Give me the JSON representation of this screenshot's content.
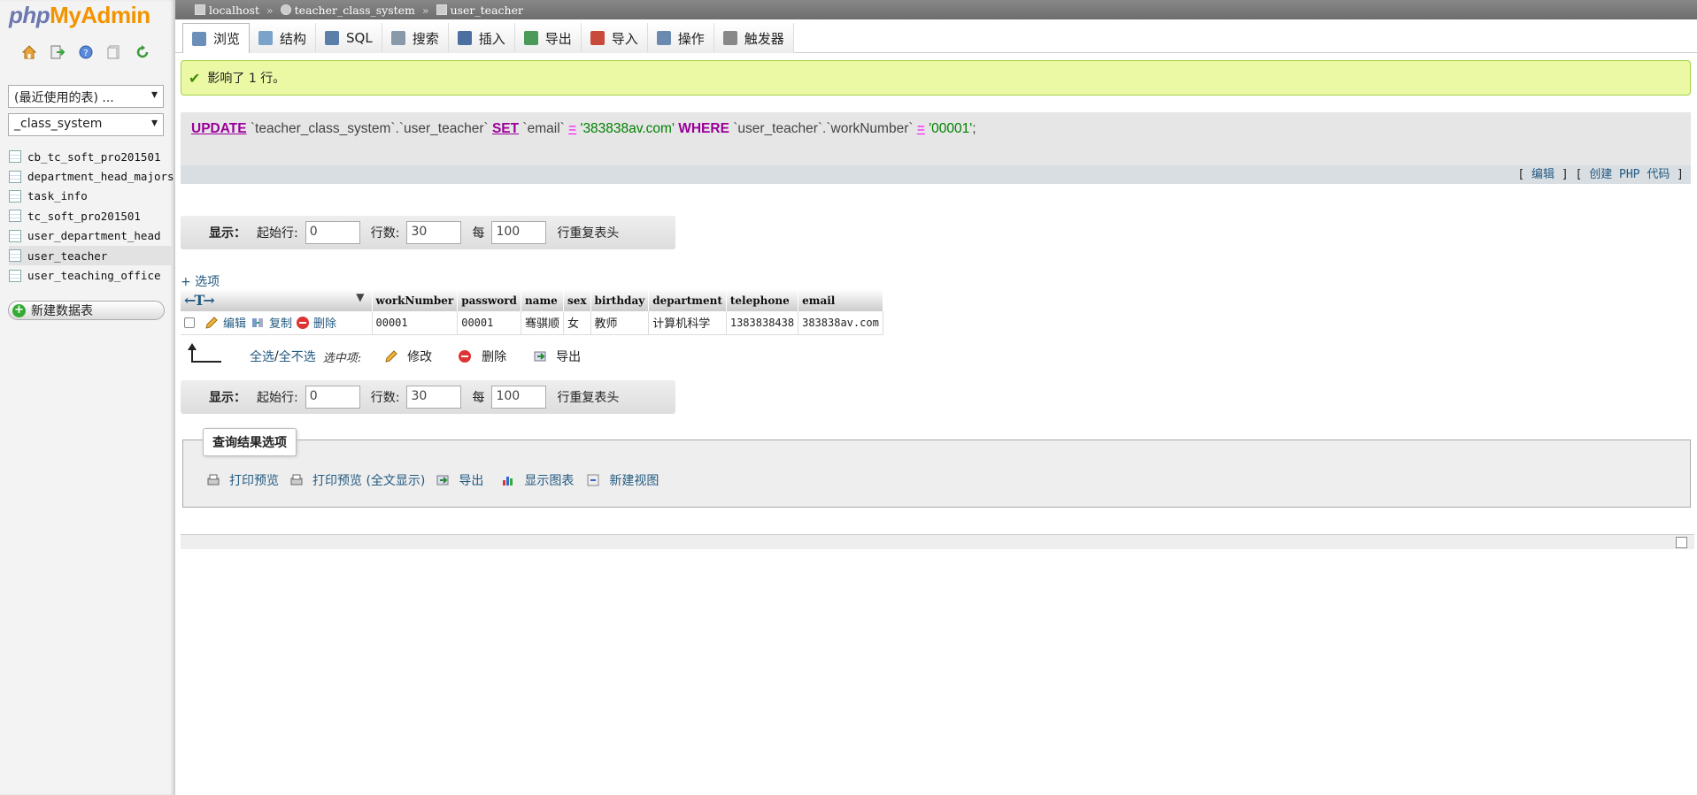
{
  "logo": {
    "php": "php",
    "my": "My",
    "admin": "Admin"
  },
  "sidebar": {
    "recent_select": "(最近使用的表) ...",
    "db_select": "_class_system",
    "tables": [
      "cb_tc_soft_pro201501",
      "department_head_majors",
      "task_info",
      "tc_soft_pro201501",
      "user_department_head",
      "user_teacher",
      "user_teaching_office"
    ],
    "active_table": "user_teacher",
    "new_table": "新建数据表"
  },
  "breadcrumb": {
    "server": "localhost",
    "database": "teacher_class_system",
    "table": "user_teacher"
  },
  "tabs": [
    {
      "label": "浏览",
      "icon": "browse-icon",
      "color": "#6b8fb8"
    },
    {
      "label": "结构",
      "icon": "structure-icon",
      "color": "#7aa3c9"
    },
    {
      "label": "SQL",
      "icon": "sql-icon",
      "color": "#5a7fa8"
    },
    {
      "label": "搜索",
      "icon": "search-icon",
      "color": "#8899aa"
    },
    {
      "label": "插入",
      "icon": "insert-icon",
      "color": "#4a6fa0"
    },
    {
      "label": "导出",
      "icon": "export-icon",
      "color": "#4a9a5a"
    },
    {
      "label": "导入",
      "icon": "import-icon",
      "color": "#c84a3a"
    },
    {
      "label": "操作",
      "icon": "wrench-icon",
      "color": "#6a8ab0"
    },
    {
      "label": "触发器",
      "icon": "trigger-icon",
      "color": "#888888"
    }
  ],
  "success_message": "影响了 1 行。",
  "sql": {
    "update": "UPDATE",
    "table_ref": " `teacher_class_system`.`user_teacher` ",
    "set": "SET",
    "col": " `email` ",
    "eq": "=",
    "val": " '383838av.com' ",
    "where": "WHERE",
    "col2": " `user_teacher`.`workNumber` ",
    "eq2": "=",
    "val2": " '00001'",
    "end": ";"
  },
  "sql_links": {
    "open": "[ ",
    "edit": "编辑",
    "mid": " ] [ ",
    "create_php": "创建 PHP 代码",
    "close": " ]"
  },
  "nav": {
    "show": "显示：",
    "start_label": "起始行:",
    "start_value": "0",
    "rows_label": "行数:",
    "rows_value": "30",
    "per_label": "每",
    "per_value": "100",
    "repeat_label": "行重复表头"
  },
  "options_link": "+ 选项",
  "columns": [
    "workNumber",
    "password",
    "name",
    "sex",
    "birthday",
    "department",
    "telephone",
    "email"
  ],
  "row": {
    "edit": "编辑",
    "copy": "复制",
    "delete": "删除",
    "values": [
      "00001",
      "00001",
      "骞骐顺",
      "女",
      "教师",
      "计算机科学",
      "1383838438",
      "383838av.com"
    ]
  },
  "bulk": {
    "check_all": "全选",
    "slash": " / ",
    "uncheck_all": "全不选",
    "with_selected": "选中项:",
    "change": "修改",
    "delete": "删除",
    "export": "导出"
  },
  "query_ops": {
    "legend": "查询结果选项",
    "print": "打印预览",
    "print_full": "打印预览 (全文显示)",
    "export": "导出",
    "chart": "显示图表",
    "create_view": "新建视图"
  }
}
